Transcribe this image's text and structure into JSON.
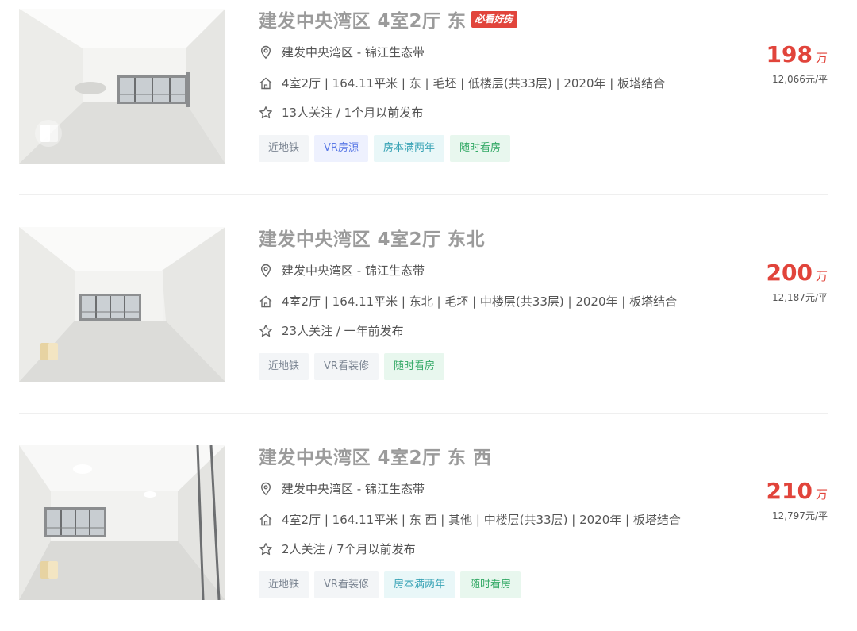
{
  "listings": [
    {
      "title": "建发中央湾区 4室2厅 东",
      "badge": "必看好房",
      "location": "建发中央湾区 - 锦江生态带",
      "info": "4室2厅 | 164.11平米 | 东 | 毛坯 | 低楼层(共33层) | 2020年 | 板塔结合",
      "follow": "13人关注 / 1个月以前发布",
      "price": "198",
      "price_unit": "万",
      "unit_price": "12,066元/平",
      "tags": [
        {
          "label": "近地铁",
          "style": "gray"
        },
        {
          "label": "VR房源",
          "style": "blue"
        },
        {
          "label": "房本满两年",
          "style": "cyan"
        },
        {
          "label": "随时看房",
          "style": "green"
        }
      ]
    },
    {
      "title": "建发中央湾区 4室2厅 东北",
      "badge": "",
      "location": "建发中央湾区 - 锦江生态带",
      "info": "4室2厅 | 164.11平米 | 东北 | 毛坯 | 中楼层(共33层) | 2020年 | 板塔结合",
      "follow": "23人关注 / 一年前发布",
      "price": "200",
      "price_unit": "万",
      "unit_price": "12,187元/平",
      "tags": [
        {
          "label": "近地铁",
          "style": "gray"
        },
        {
          "label": "VR看装修",
          "style": "gray"
        },
        {
          "label": "随时看房",
          "style": "green"
        }
      ]
    },
    {
      "title": "建发中央湾区 4室2厅 东 西",
      "badge": "",
      "location": "建发中央湾区 - 锦江生态带",
      "info": "4室2厅 | 164.11平米 | 东 西 | 其他 | 中楼层(共33层) | 2020年 | 板塔结合",
      "follow": "2人关注 / 7个月以前发布",
      "price": "210",
      "price_unit": "万",
      "unit_price": "12,797元/平",
      "tags": [
        {
          "label": "近地铁",
          "style": "gray"
        },
        {
          "label": "VR看装修",
          "style": "gray"
        },
        {
          "label": "房本满两年",
          "style": "cyan"
        },
        {
          "label": "随时看房",
          "style": "green"
        }
      ]
    }
  ],
  "colors": {
    "price": "#e1443b",
    "title": "#9b9b9b",
    "badge": "#e1443b"
  }
}
